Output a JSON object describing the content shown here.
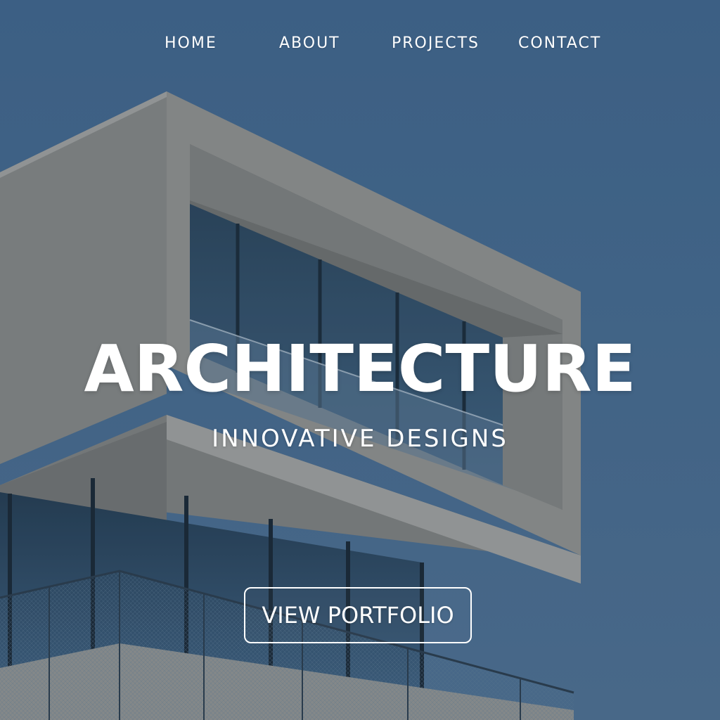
{
  "nav": {
    "items": [
      {
        "label": "HOME"
      },
      {
        "label": "ABOUT"
      },
      {
        "label": "PROJECTS"
      },
      {
        "label": "CONTACT"
      }
    ]
  },
  "hero": {
    "title": "ARCHITECTURE",
    "subtitle": "INNOVATIVE DESIGNS",
    "cta_label": "VIEW PORTFOLIO",
    "image": "modern-building-photo"
  },
  "colors": {
    "sky": "#3f6386",
    "facade": "#8e8e8b",
    "glass": "#2f4a62",
    "text": "#ffffff"
  }
}
